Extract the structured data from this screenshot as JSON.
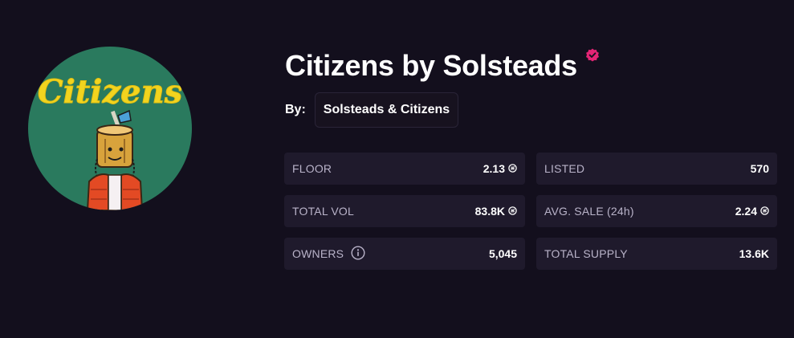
{
  "collection": {
    "title": "Citizens by Solsteads",
    "logo_text": "Citizens",
    "by_label": "By:",
    "creator": "Solsteads & Citizens",
    "verified_icon": "verified-check-icon"
  },
  "colors": {
    "background": "#130f1d",
    "card": "#1f1a2c",
    "verified": "#e42575",
    "avatar_bg": "#2a7a5e",
    "logo_yellow": "#f2d41f"
  },
  "stats": {
    "floor": {
      "label": "FLOOR",
      "value": "2.13",
      "icon": "sol-icon"
    },
    "listed": {
      "label": "LISTED",
      "value": "570"
    },
    "total_vol": {
      "label": "TOTAL VOL",
      "value": "83.8K",
      "icon": "sol-icon"
    },
    "avg_sale": {
      "label": "AVG. SALE (24h)",
      "value": "2.24",
      "icon": "sol-icon"
    },
    "owners": {
      "label": "OWNERS",
      "value": "5,045",
      "icon": "info-icon"
    },
    "total_supply": {
      "label": "TOTAL SUPPLY",
      "value": "13.6K"
    }
  }
}
